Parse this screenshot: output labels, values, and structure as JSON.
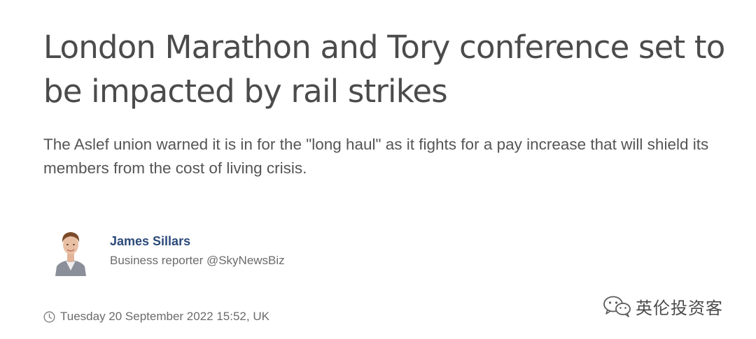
{
  "article": {
    "headline": "London Marathon and Tory conference set to be impacted by rail strikes",
    "standfirst": "The Aslef union warned it is in for the \"long haul\" as it fights for a pay increase that will shield its members from the cost of living crisis."
  },
  "byline": {
    "author_name": "James Sillars",
    "author_role": "Business reporter @SkyNewsBiz"
  },
  "published": {
    "timestamp": "Tuesday 20 September 2022 15:52, UK"
  },
  "watermark": {
    "text": "英伦投资客"
  },
  "colors": {
    "author_link": "#2c4a7a",
    "headline_text": "#4b4b4b",
    "meta_text": "#6b6b6b"
  },
  "icons": {
    "timestamp": "clock-icon",
    "watermark": "wechat-logo-icon"
  }
}
